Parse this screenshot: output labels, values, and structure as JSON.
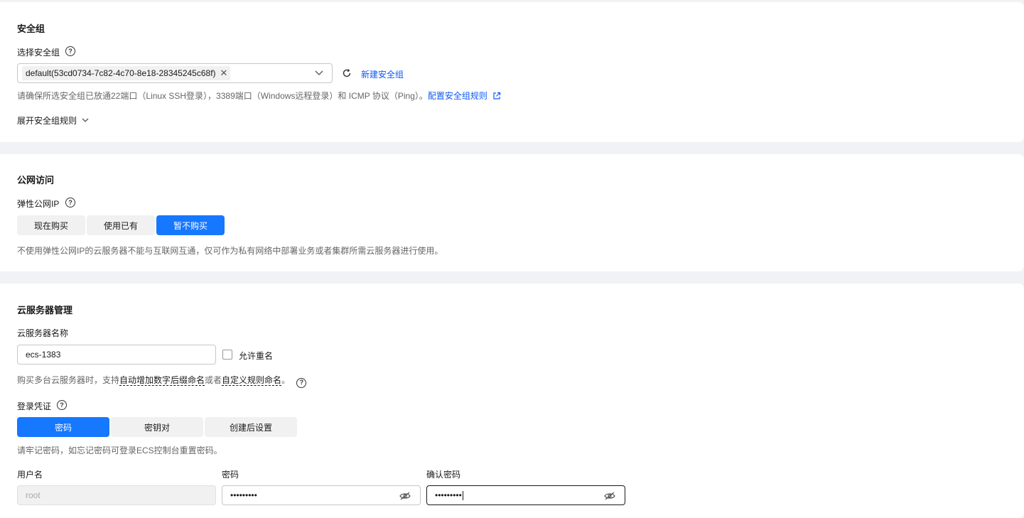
{
  "security_group": {
    "title": "安全组",
    "select_label": "选择安全组",
    "selected_tag": "default(53cd0734-7c82-4c70-8e18-28345245c68f)",
    "create_link": "新建安全组",
    "hint_text": "请确保所选安全组已放通22端口（Linux SSH登录），3389端口（Windows远程登录）和 ICMP 协议（Ping）。",
    "config_link": "配置安全组规则",
    "expand_label": "展开安全组规则"
  },
  "public_access": {
    "title": "公网访问",
    "eip_label": "弹性公网IP",
    "options": [
      "现在购买",
      "使用已有",
      "暂不购买"
    ],
    "selected_option": "暂不购买",
    "hint_text": "不使用弹性公网IP的云服务器不能与互联网互通，仅可作为私有网络中部署业务或者集群所需云服务器进行使用。"
  },
  "server_management": {
    "title": "云服务器管理",
    "name_label": "云服务器名称",
    "name_value": "ecs-1383",
    "allow_duplicate_label": "允许重名",
    "allow_duplicate_checked": false,
    "naming_hint_prefix": "购买多台云服务器时，支持",
    "naming_hint_auto": "自动增加数字后缀命名",
    "naming_hint_or": "或者",
    "naming_hint_custom": "自定义规则命名",
    "naming_hint_suffix": "。",
    "credential_label": "登录凭证",
    "credential_options": [
      "密码",
      "密钥对",
      "创建后设置"
    ],
    "selected_credential": "密码",
    "password_hint": "请牢记密码，如忘记密码可登录ECS控制台重置密码。",
    "username_label": "用户名",
    "username_value": "root",
    "password_label": "密码",
    "password_value": "•••••••••",
    "confirm_label": "确认密码",
    "confirm_value": "•••••••••"
  },
  "icons": {
    "help": "question-circle-icon",
    "close": "close-icon",
    "dropdown": "chevron-down-icon",
    "refresh": "refresh-icon",
    "external": "external-link-icon",
    "eye": "eye-off-icon"
  },
  "colors": {
    "primary": "#1677ff",
    "link": "#0a59f7",
    "background": "#f0f2f5"
  }
}
